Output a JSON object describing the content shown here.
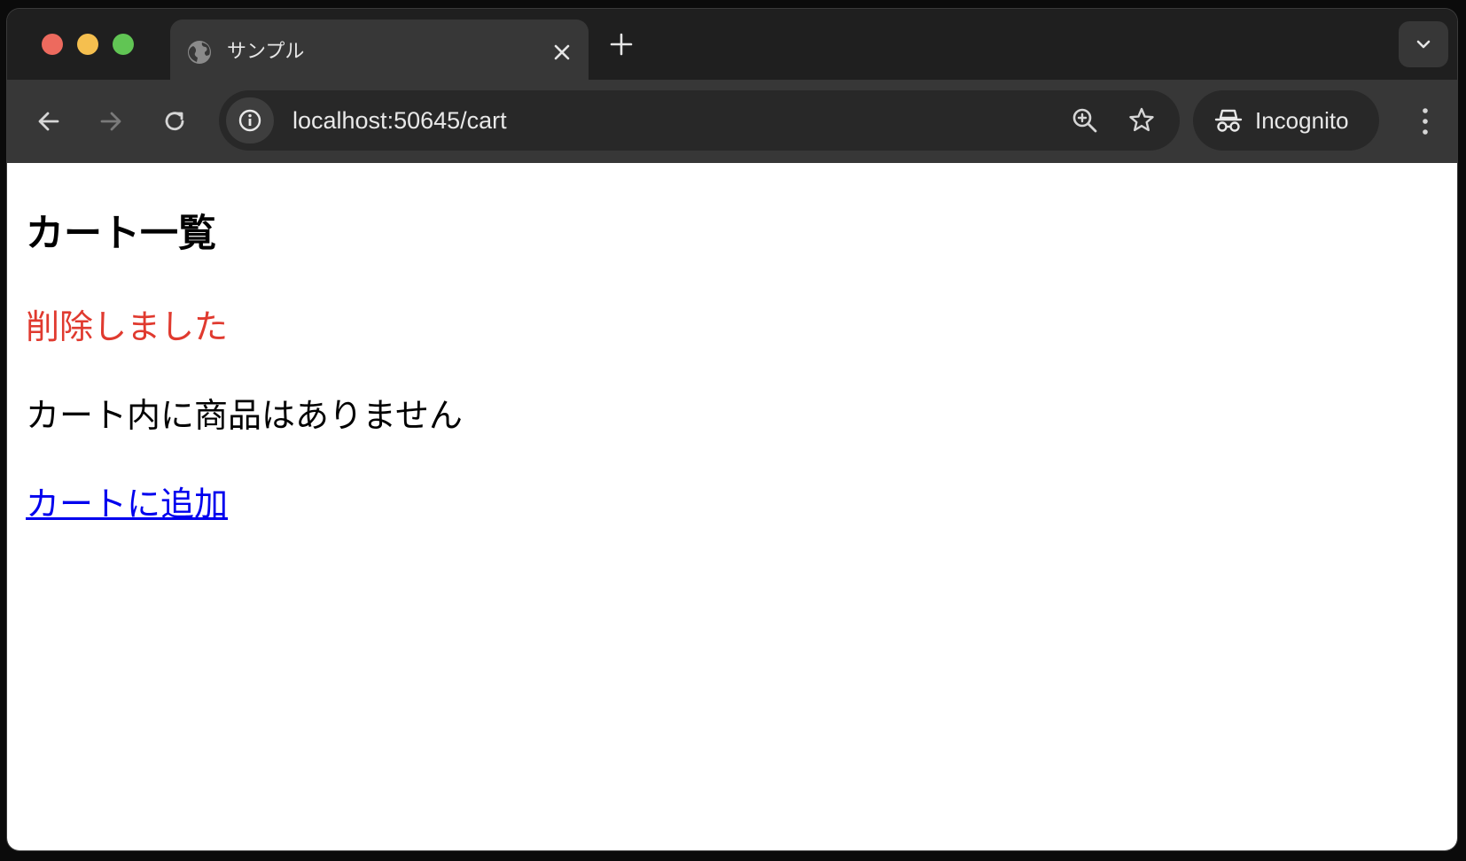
{
  "browser": {
    "tab_title": "サンプル",
    "url": "localhost:50645/cart",
    "profile_label": "Incognito",
    "icons": {
      "close": "traffic-light-close",
      "minimize": "traffic-light-minimize",
      "maximize": "traffic-light-maximize",
      "tab_favicon": "globe-icon",
      "tab_close": "close-icon",
      "new_tab": "plus-icon",
      "tab_search": "chevron-down-icon",
      "back": "arrow-left-icon",
      "forward": "arrow-right-icon",
      "reload": "reload-icon",
      "site_info": "info-icon",
      "zoom": "zoom-in-icon",
      "bookmark": "star-icon",
      "incognito": "incognito-icon",
      "menu": "kebab-menu-icon"
    },
    "colors": {
      "traffic_red": "#ed6a5e",
      "traffic_yellow": "#f5bf4f",
      "traffic_green": "#61c554"
    }
  },
  "page": {
    "title": "カート一覧",
    "deleted_message": "削除しました",
    "empty_message": "カート内に商品はありません",
    "add_link": "カートに追加",
    "colors": {
      "message": "#e03a2f",
      "link": "#0000ee"
    }
  }
}
